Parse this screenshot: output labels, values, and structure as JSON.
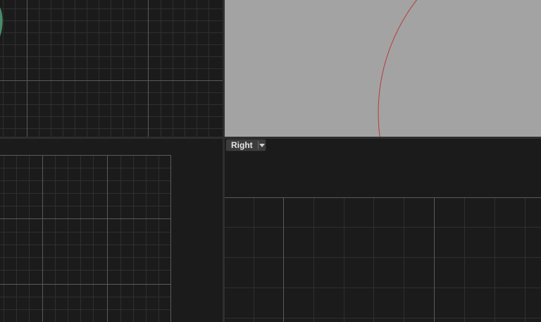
{
  "viewports": {
    "bottom_right": {
      "label": "Right"
    }
  },
  "icons": {
    "view_menu": "chevron-down-icon"
  },
  "colors": {
    "viewport_bg": "#1b1b1b",
    "shaded_viewport_bg": "#a3a3a3",
    "grid_minor": "#2f2f2f",
    "grid_major": "#5a5a5a",
    "circle_edge": "#b83a3a",
    "mesh_blue": "#2c3f86",
    "mesh_green": "#4a8a68",
    "splitter": "#2e2e2e"
  }
}
